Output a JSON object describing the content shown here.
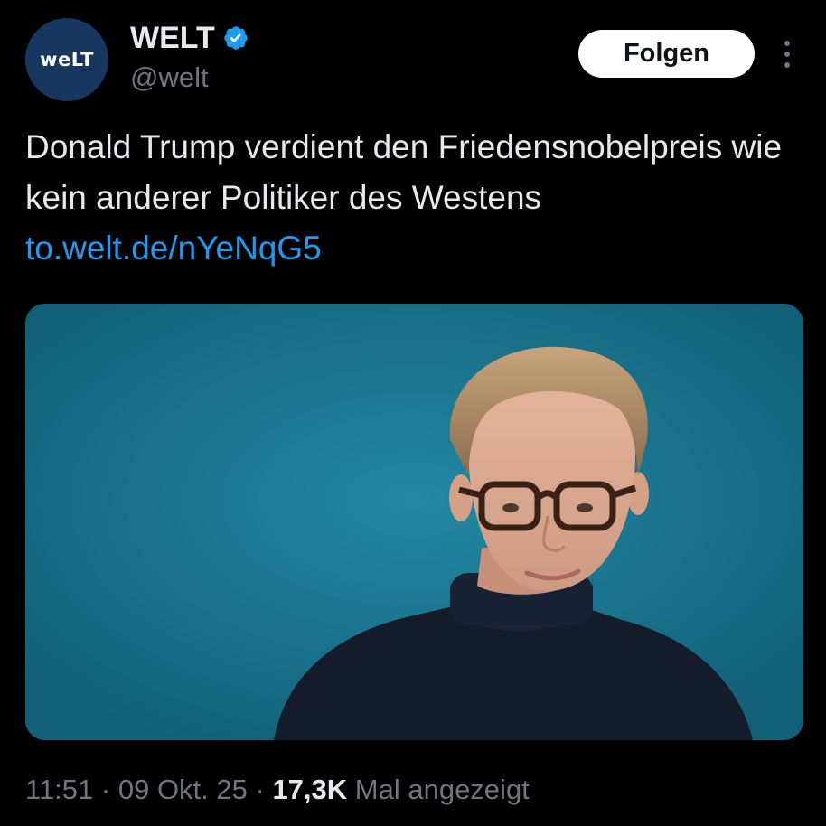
{
  "account": {
    "avatar_text": "weLT",
    "display_name": "WELT",
    "handle": "@welt",
    "verified_icon": "verified-badge-icon"
  },
  "actions": {
    "follow_label": "Folgen",
    "more_icon": "more-options-icon"
  },
  "tweet": {
    "text": "Donald Trump verdient den Friedensnobelpreis wie kein anderer Politiker des Westens",
    "link": "to.welt.de/nYeNqG5"
  },
  "meta": {
    "time": "11:51",
    "separator1": " · ",
    "date": "09 Okt. 25",
    "separator2": " · ",
    "views": "17,3K",
    "views_label": " Mal angezeigt"
  },
  "colors": {
    "background": "#000000",
    "text": "#e7e9ea",
    "secondary": "#71767b",
    "link": "#1d9bf0",
    "avatar": "#17375e",
    "photo_bg": "#1a7390"
  }
}
